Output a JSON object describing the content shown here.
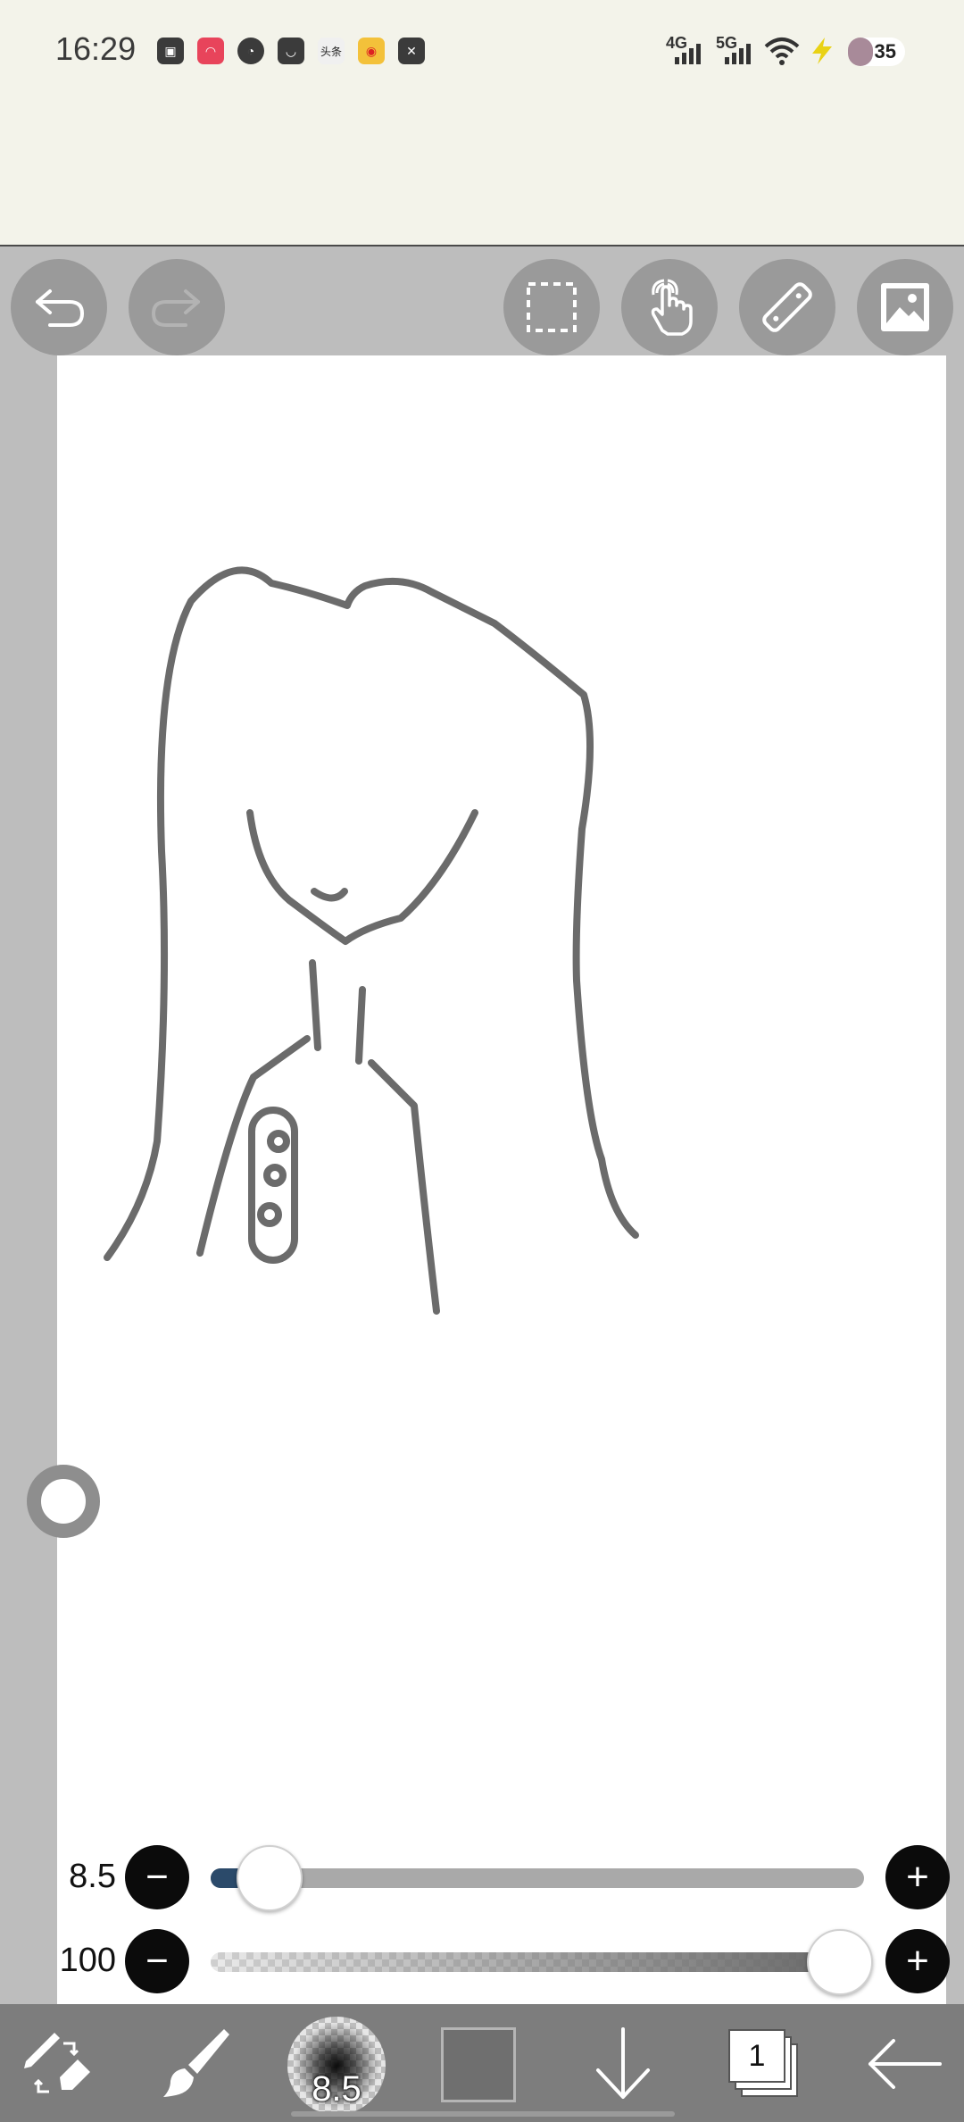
{
  "status_bar": {
    "time": "16:29",
    "network_1": "4G",
    "network_2": "5G",
    "battery_level": "35",
    "notification_icons": [
      "bilibili-icon",
      "meituan-icon",
      "compass-icon",
      "shopping-bag-icon",
      "toutiao-icon",
      "weibo-icon",
      "capcut-icon"
    ],
    "toutiao_label": "头条"
  },
  "toolbar": {
    "buttons": [
      "undo-icon",
      "redo-icon",
      "selection-icon",
      "hand-tool-icon",
      "ruler-icon",
      "image-import-icon"
    ],
    "redo_enabled": false
  },
  "brush_size_slider": {
    "value_label": "8.5",
    "fraction": 0.09
  },
  "opacity_slider": {
    "value_label": "100",
    "fraction": 1.0
  },
  "bottom_bar": {
    "brush_preview_label": "8.5",
    "layer_count": "1",
    "current_color": "#6f6f6f"
  },
  "colors": {
    "status_bg": "#f3f3ea",
    "toolbar_bg": "#bdbdbd",
    "canvas_bg": "#ffffff",
    "stroke": "#6b6b6b",
    "slider_accent": "#2b4a6a",
    "bottom_bar_bg": "#7d7d7d"
  }
}
